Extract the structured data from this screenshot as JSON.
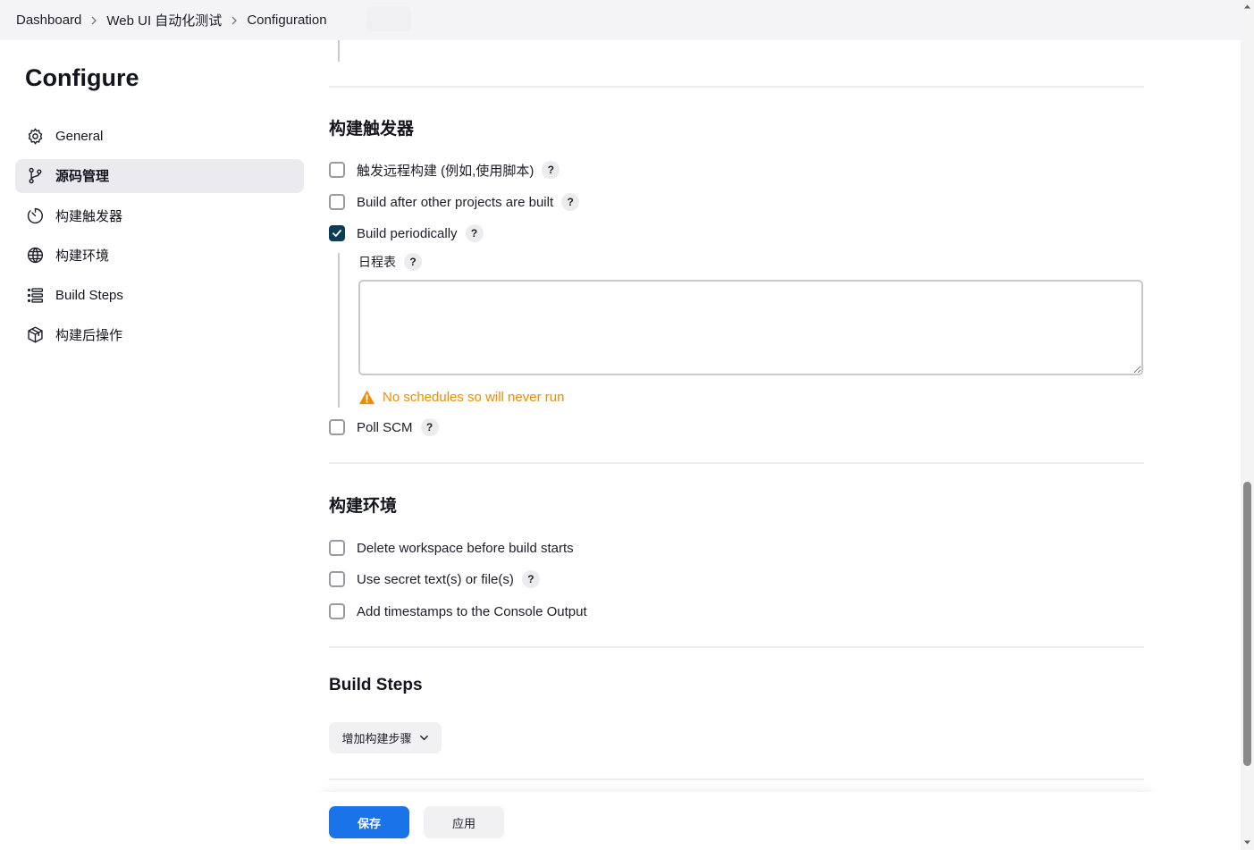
{
  "breadcrumb": {
    "items": [
      "Dashboard",
      "Web UI 自动化测试",
      "Configuration"
    ]
  },
  "sidebar": {
    "title": "Configure",
    "items": [
      {
        "label": "General",
        "icon": "gear-icon"
      },
      {
        "label": "源码管理",
        "icon": "branch-icon",
        "active": true
      },
      {
        "label": "构建触发器",
        "icon": "timer-icon"
      },
      {
        "label": "构建环境",
        "icon": "globe-icon"
      },
      {
        "label": "Build Steps",
        "icon": "list-icon"
      },
      {
        "label": "构建后操作",
        "icon": "package-icon"
      }
    ]
  },
  "triggers": {
    "title": "构建触发器",
    "options": [
      {
        "label": "触发远程构建 (例如,使用脚本)",
        "checked": false,
        "help": "?"
      },
      {
        "label": "Build after other projects are built",
        "checked": false,
        "help": "?"
      },
      {
        "label": "Build periodically",
        "checked": true,
        "help": "?"
      },
      {
        "label": "Poll SCM",
        "checked": false,
        "help": "?"
      }
    ],
    "schedule": {
      "label": "日程表",
      "help": "?",
      "value": "",
      "warning": "No schedules so will never run"
    }
  },
  "environment": {
    "title": "构建环境",
    "options": [
      {
        "label": "Delete workspace before build starts",
        "checked": false
      },
      {
        "label": "Use secret text(s) or file(s)",
        "checked": false,
        "help": "?"
      },
      {
        "label": "Add timestamps to the Console Output",
        "checked": false
      }
    ]
  },
  "build_steps": {
    "title": "Build Steps",
    "add_label": "增加构建步骤"
  },
  "footer": {
    "save_label": "保存",
    "apply_label": "应用"
  },
  "colors": {
    "primary": "#1a73e8",
    "checkbox_checked": "#0b3d57",
    "warning": "#f08c00",
    "active_nav_bg": "#ebebef"
  }
}
